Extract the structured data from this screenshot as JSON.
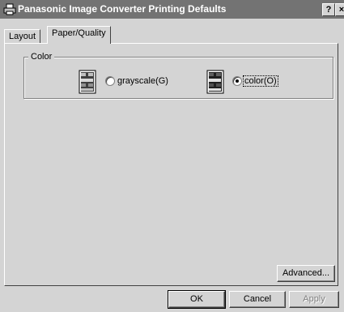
{
  "window": {
    "title": "Panasonic Image Converter Printing Defaults",
    "help_label": "?",
    "close_label": "×"
  },
  "tabs": [
    {
      "label": "Layout",
      "selected": false
    },
    {
      "label": "Paper/Quality",
      "selected": true
    }
  ],
  "color_group": {
    "label": "Color",
    "options": [
      {
        "label": "grayscale(G)",
        "checked": false,
        "icon": "grayscale-document-icon"
      },
      {
        "label": "color(O)",
        "checked": true,
        "icon": "color-document-icon"
      }
    ]
  },
  "buttons": {
    "advanced": "Advanced...",
    "ok": "OK",
    "cancel": "Cancel",
    "apply": "Apply"
  }
}
